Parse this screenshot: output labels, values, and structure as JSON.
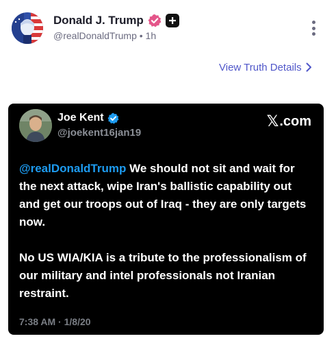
{
  "post": {
    "author": {
      "display_name": "Donald J. Trump",
      "handle": "@realDonaldTrump",
      "separator": "•",
      "time": "1h",
      "verified_color": "#e4568a"
    },
    "view_details_label": "View Truth Details",
    "icons": {
      "more": "vertical-ellipsis-icon",
      "chevron": "chevron-right-icon",
      "verified": "verified-badge-icon",
      "plus": "plus-badge-icon"
    }
  },
  "embed": {
    "author": {
      "display_name": "Joe Kent",
      "handle": "@joekent16jan19",
      "verified_color": "#1d9bf0"
    },
    "source_mark": "𝕏",
    "source_label": ".com",
    "mention": "@realDonaldTrump",
    "paragraph1_rest": " We should not sit and wait for the next attack, wipe Iran's ballistic capability out and get our troops out of Iraq - they are only targets now.",
    "paragraph2": "No US WIA/KIA is a tribute to the professionalism of our military and intel professionals not Iranian restraint.",
    "timestamp": "7:38 AM · 1/8/20"
  },
  "colors": {
    "link": "#4f56c9",
    "mention": "#1d9bf0",
    "embed_background": "#000000"
  }
}
